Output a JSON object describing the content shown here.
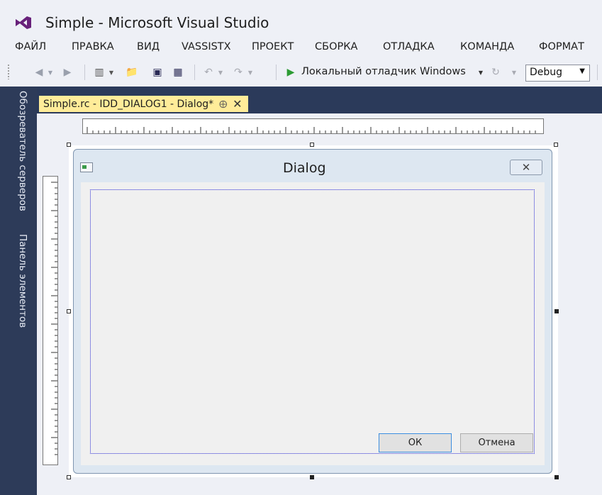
{
  "window": {
    "title": "Simple - Microsoft Visual Studio"
  },
  "menu": [
    "ФАЙЛ",
    "ПРАВКА",
    "ВИД",
    "VASSISTX",
    "ПРОЕКТ",
    "СБОРКА",
    "ОТЛАДКА",
    "КОМАНДА",
    "ФОРМАТ"
  ],
  "toolbar": {
    "debugger_label": "Локальный отладчик Windows",
    "configuration": "Debug"
  },
  "side_panels": [
    "Обозреватель серверов",
    "Панель элементов"
  ],
  "document_tab": {
    "label": "Simple.rc - IDD_DIALOG1 - Dialog*"
  },
  "dialog": {
    "title": "Dialog",
    "ok_label": "ОК",
    "cancel_label": "Отмена"
  },
  "colors": {
    "chrome": "#eef0f6",
    "sidebar": "#2d3b59",
    "active_tab": "#ffec99",
    "accent_focus": "#3c8ee0"
  }
}
